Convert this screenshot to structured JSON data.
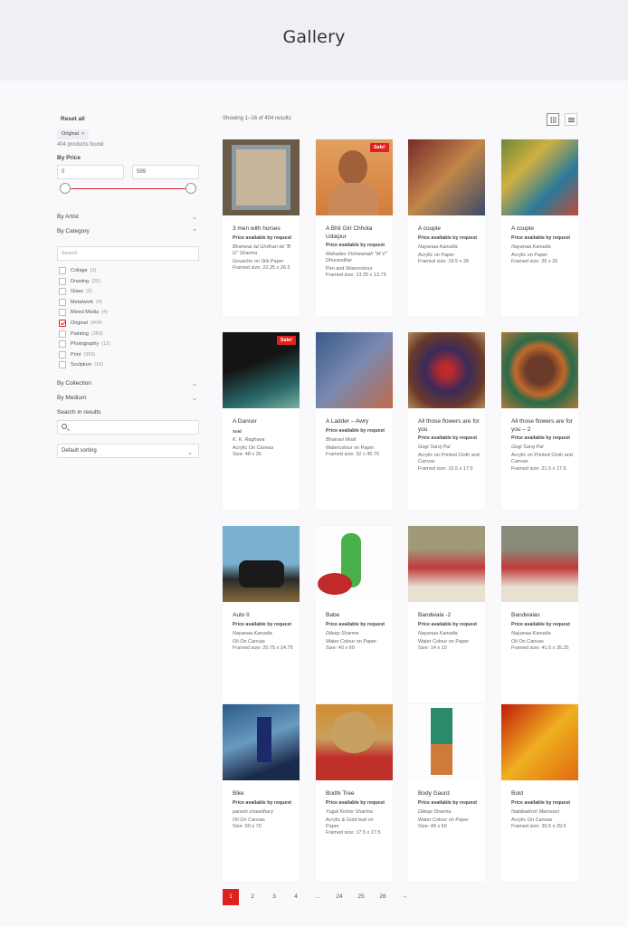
{
  "page": {
    "title": "Gallery"
  },
  "sidebar": {
    "reset_label": "Reset all",
    "active_chip": "Original",
    "chip_close": "×",
    "products_found": "404 products found",
    "price": {
      "label": "By Price",
      "min": "0",
      "max": "599"
    },
    "filters": {
      "artist": "By Artist",
      "category": "By Category",
      "collection": "By Collection",
      "medium": "By Medium",
      "search_in_results": "Search in results"
    },
    "category_search_placeholder": "Search",
    "categories": [
      {
        "name": "Collage",
        "count": "(3)",
        "checked": false
      },
      {
        "name": "Drawing",
        "count": "(26)",
        "checked": false
      },
      {
        "name": "Glass",
        "count": "(3)",
        "checked": false
      },
      {
        "name": "Metalwork",
        "count": "(4)",
        "checked": false
      },
      {
        "name": "Mixed Media",
        "count": "(4)",
        "checked": false
      },
      {
        "name": "Original",
        "count": "(404)",
        "checked": true
      },
      {
        "name": "Painting",
        "count": "(360)",
        "checked": false
      },
      {
        "name": "Photography",
        "count": "(12)",
        "checked": false
      },
      {
        "name": "Print",
        "count": "(393)",
        "checked": false
      },
      {
        "name": "Sculpture",
        "count": "(18)",
        "checked": false
      }
    ],
    "sorting": "Default sorting"
  },
  "results": {
    "showing": "Showing 1–16 of 404 results"
  },
  "products": [
    {
      "title": "3 men with horses",
      "price": "Price available by request",
      "artist": "Bhanwar lal Girdhari lal \"B G\" Sharma",
      "details": [
        "Gouache on Silk Paper",
        "Framed size: 22.25 x 26.5"
      ],
      "sale": ""
    },
    {
      "title": "A Bhil Girl Chhota Udaipur",
      "price": "Price available by request",
      "artist": "Mahadev Vishwanath \"M V\" Dhurandhar",
      "details": [
        "Pen and Watercolour",
        "Framed size: 13.25 x 13.75"
      ],
      "sale": "Sale!"
    },
    {
      "title": "A couple",
      "price": "Price available by request",
      "artist": "Nayanaa Kanodia",
      "details": [
        "Acrylic on Paper",
        "Framed size: 19.5 x 28"
      ],
      "sale": ""
    },
    {
      "title": "A couple",
      "price": "Price available by request",
      "artist": "Nayanaa Kanodia",
      "details": [
        "Acrylic on Paper",
        "Framed size: 26 x 20"
      ],
      "sale": ""
    },
    {
      "title": "A Dancer",
      "price": "Sold",
      "artist": "K. K. Raghava",
      "details": [
        "Acrylic On Canvas",
        "Size: 48 x 36"
      ],
      "sale": "Sale!"
    },
    {
      "title": "A Ladder – Awry",
      "price": "Price available by request",
      "artist": "Bhairavi Modi",
      "details": [
        "Watercolour on Paper",
        "Framed size: 32 x 45.75"
      ],
      "sale": ""
    },
    {
      "title": "All those flowers are for you",
      "price": "Price available by request",
      "artist": "Gogi Saroj Pal",
      "details": [
        "Acrylic on Printed Cloth and Canvas",
        "Framed size: 15.5 x 17.5"
      ],
      "sale": ""
    },
    {
      "title": "All those flowers are for you – 2",
      "price": "Price available by request",
      "artist": "Gogi Saroj Pal",
      "details": [
        "Acrylic on Printed Cloth and Canvas",
        "Framed size: 21.5 x 17.5"
      ],
      "sale": ""
    },
    {
      "title": "Auto II",
      "price": "Price available by request",
      "artist": "Nayanaa Kanodia",
      "details": [
        "Oil On Canvas",
        "Framed size: 20.75 x 24.75"
      ],
      "sale": ""
    },
    {
      "title": "Babe",
      "price": "Price available by request",
      "artist": "Dileep Sharma",
      "details": [
        "Water Colour on Paper",
        "Size: 40 x 60"
      ],
      "sale": ""
    },
    {
      "title": "Bandwala -2",
      "price": "Price available by request",
      "artist": "Nayanaa Kanodia",
      "details": [
        "Water Colour on Paper",
        "Size: 14 x 10"
      ],
      "sale": ""
    },
    {
      "title": "Bandwalas",
      "price": "Price available by request",
      "artist": "Nayanaa Kanodia",
      "details": [
        "Oil On Canvas",
        "Framed size: 41.5 x 35.25"
      ],
      "sale": ""
    },
    {
      "title": "Bike",
      "price": "Price available by request",
      "artist": "paresh chawdhary",
      "details": [
        "Oil On Canvas",
        "Size: 60 x 70"
      ],
      "sale": ""
    },
    {
      "title": "Bodhi Tree",
      "price": "Price available by request",
      "artist": "Yugal Kishor Sharma",
      "details": [
        "Acrylic & Gold leaf on Paper",
        "Framed size: 17.5 x 17.5"
      ],
      "sale": ""
    },
    {
      "title": "Body Gaurd",
      "price": "Price available by request",
      "artist": "Dileep Sharma",
      "details": [
        "Water Colour on Paper",
        "Size: 48 x 60"
      ],
      "sale": ""
    },
    {
      "title": "Bold",
      "price": "Price available by request",
      "artist": "Nabibakhsh Mansoori",
      "details": [
        "Acrylic On Canvas",
        "Framed size: 39.5 x 39.5"
      ],
      "sale": ""
    }
  ],
  "pagination": [
    "1",
    "2",
    "3",
    "4",
    "…",
    "24",
    "25",
    "26",
    "→"
  ],
  "colors": {
    "accent": "#dd2222"
  }
}
